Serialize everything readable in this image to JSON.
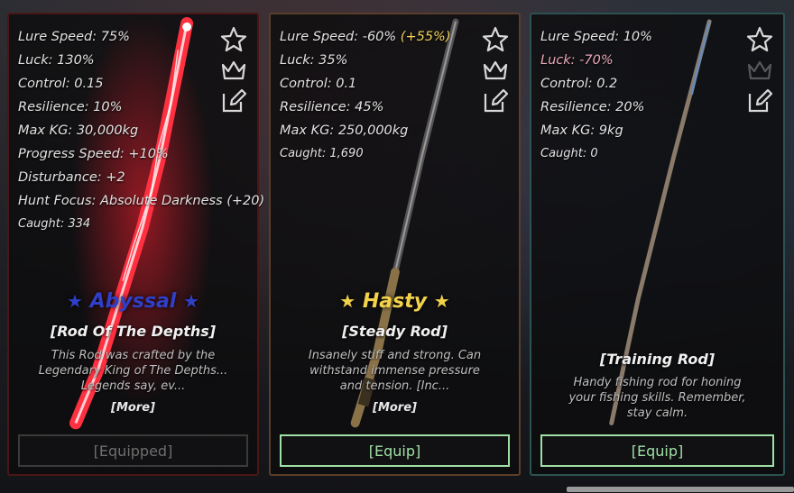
{
  "cards": [
    {
      "stats": [
        {
          "label": "Lure Speed: 75%"
        },
        {
          "label": "Luck: 130%"
        },
        {
          "label": "Control: 0.15"
        },
        {
          "label": "Resilience: 10%"
        },
        {
          "label": "Max KG: 30,000kg"
        },
        {
          "label": "Progress Speed: +10%"
        },
        {
          "label": "Disturbance: +2"
        },
        {
          "label": "Hunt Focus: Absolute Darkness (+20)"
        }
      ],
      "caught": "Caught: 334",
      "rarity": "Abyssal",
      "rarity_color": "#2f3fc8",
      "star": "★",
      "name": "[Rod Of The Depths]",
      "description": "This Rod was crafted by the Legendary King of The Depths... Legends say, ev...",
      "more": "[More]",
      "button": "[Equipped]"
    },
    {
      "stats_html": true,
      "lure_prefix": "Lure Speed: -60% ",
      "lure_bonus": "(+55%)",
      "stats": [
        {
          "label": "Luck: 35%"
        },
        {
          "label": "Control: 0.1"
        },
        {
          "label": "Resilience: 45%"
        },
        {
          "label": "Max KG: 250,000kg"
        }
      ],
      "caught": "Caught: 1,690",
      "rarity": "Hasty",
      "rarity_color": "#f2d24a",
      "star": "★",
      "name": "[Steady Rod]",
      "description": "Insanely stiff and strong. Can withstand immense pressure and tension. [Inc...",
      "more": "[More]",
      "button": "[Equip]"
    },
    {
      "stats": [
        {
          "label": "Lure Speed: 10%"
        }
      ],
      "luck": "Luck: -70%",
      "stats2": [
        {
          "label": "Control: 0.2"
        },
        {
          "label": "Resilience: 20%"
        },
        {
          "label": "Max KG: 9kg"
        }
      ],
      "caught": "Caught: 0",
      "name": "[Training Rod]",
      "description": "Handy fishing rod for honing your fishing skills. Remember, stay calm.",
      "button": "[Equip]"
    }
  ],
  "icons": [
    "favorite-star-icon",
    "crown-icon",
    "edit-icon"
  ]
}
